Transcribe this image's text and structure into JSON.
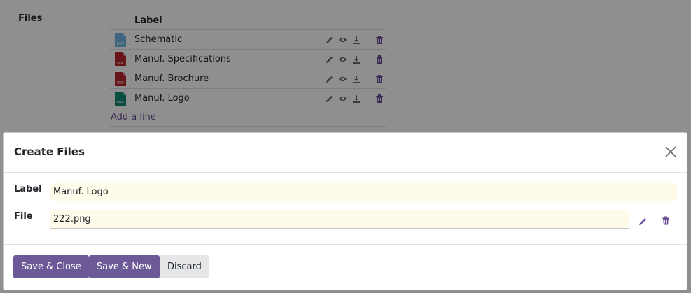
{
  "background": {
    "section_label": "Files",
    "table_header": "Label",
    "files": [
      {
        "label": "Schematic",
        "type": "DXF"
      },
      {
        "label": "Manuf. Specifications",
        "type": "PDF"
      },
      {
        "label": "Manuf. Brochure",
        "type": "PDF"
      },
      {
        "label": "Manuf. Logo",
        "type": "PNG"
      }
    ],
    "add_line": "Add a line"
  },
  "modal": {
    "title": "Create Files",
    "fields": {
      "label_label": "Label",
      "label_value": "Manuf. Logo",
      "file_label": "File",
      "file_value": "222.png"
    },
    "buttons": {
      "save_close": "Save & Close",
      "save_new": "Save & New",
      "discard": "Discard"
    }
  },
  "colors": {
    "primary": "#6c5a98",
    "link": "#6c4f94",
    "input_bg": "#fefbeb",
    "pdf": "#b8262e",
    "png": "#148a74",
    "dxf": "#4da5d6"
  },
  "icons": {
    "row_actions": [
      "pencil-icon",
      "eye-icon",
      "download-icon",
      "trash-icon"
    ],
    "close": "close-icon"
  }
}
